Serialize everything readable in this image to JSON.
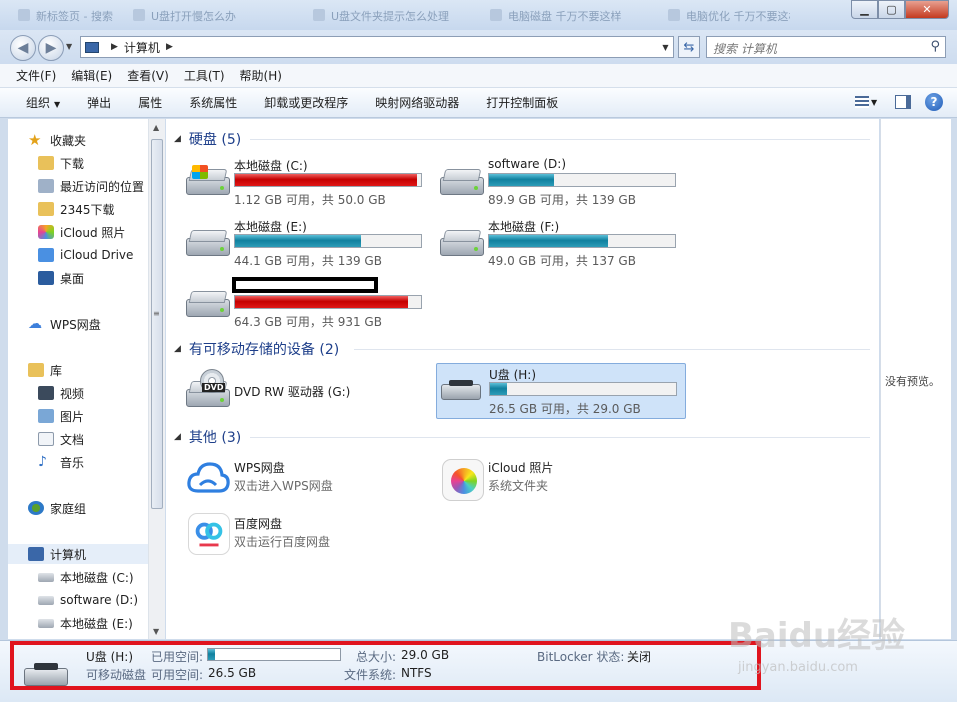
{
  "window": {
    "tabs": [
      "新标签页 - 搜索",
      "U盘打开慢怎么办",
      "U盘文件夹提示怎么处理",
      "电脑磁盘 千万不要这样",
      "电脑优化 千万不要这样"
    ],
    "minimize_icon": "minimize-icon",
    "maximize_icon": "maximize-icon",
    "close_label": "✕"
  },
  "address": {
    "crumb": "计算机",
    "search_placeholder": "搜索 计算机"
  },
  "menu": [
    "文件(F)",
    "编辑(E)",
    "查看(V)",
    "工具(T)",
    "帮助(H)"
  ],
  "commands": {
    "organize": "组织",
    "items": [
      "弹出",
      "属性",
      "系统属性",
      "卸载或更改程序",
      "映射网络驱动器",
      "打开控制面板"
    ]
  },
  "nav": {
    "favorites": "收藏夹",
    "fav_items": [
      "下载",
      "最近访问的位置",
      "2345下载",
      "iCloud 照片",
      "iCloud Drive",
      "桌面"
    ],
    "wps": "WPS网盘",
    "libraries": "库",
    "lib_items": [
      "视频",
      "图片",
      "文档",
      "音乐"
    ],
    "homegroup": "家庭组",
    "computer": "计算机",
    "comp_items": [
      "本地磁盘 (C:)",
      "software (D:)",
      "本地磁盘 (E:)"
    ]
  },
  "groups": {
    "hdd": "硬盘 (5)",
    "removable": "有可移动存储的设备 (2)",
    "other": "其他 (3)"
  },
  "drives": [
    {
      "name": "本地磁盘 (C:)",
      "free": "1.12 GB 可用，共 50.0 GB",
      "used_fraction": 0.98,
      "color": "#c40000"
    },
    {
      "name": "software (D:)",
      "free": "89.9 GB 可用，共 139 GB",
      "used_fraction": 0.35,
      "color": "#10809f"
    },
    {
      "name": "本地磁盘 (E:)",
      "free": "44.1 GB 可用，共 139 GB",
      "used_fraction": 0.68,
      "color": "#10809f"
    },
    {
      "name": "本地磁盘 (F:)",
      "free": "49.0 GB 可用，共 137 GB",
      "used_fraction": 0.64,
      "color": "#10809f"
    },
    {
      "name": "",
      "free": "64.3 GB 可用，共 931 GB",
      "used_fraction": 0.93,
      "color": "#c40000"
    }
  ],
  "removable": [
    {
      "name": "DVD RW 驱动器 (G:)"
    },
    {
      "name": "U盘 (H:)",
      "free": "26.5 GB 可用，共 29.0 GB",
      "used_fraction": 0.09
    }
  ],
  "others": [
    {
      "name": "WPS网盘",
      "desc": "双击进入WPS网盘"
    },
    {
      "name": "iCloud 照片",
      "desc": "系统文件夹"
    },
    {
      "name": "百度网盘",
      "desc": "双击运行百度网盘"
    }
  ],
  "preview": {
    "text": "没有预览。"
  },
  "details": {
    "name": "U盘 (H:)",
    "type": "可移动磁盘",
    "used_label": "已用空间:",
    "free_label": "可用空间:",
    "free_value": "26.5 GB",
    "total_label": "总大小:",
    "total_value": "29.0 GB",
    "fs_label": "文件系统:",
    "fs_value": "NTFS",
    "bitlocker_label": "BitLocker 状态:",
    "bitlocker_value": "关闭",
    "used_fraction": 0.05
  },
  "watermark": {
    "main": "Baidu经验",
    "sub": "jingyan.baidu.com"
  }
}
